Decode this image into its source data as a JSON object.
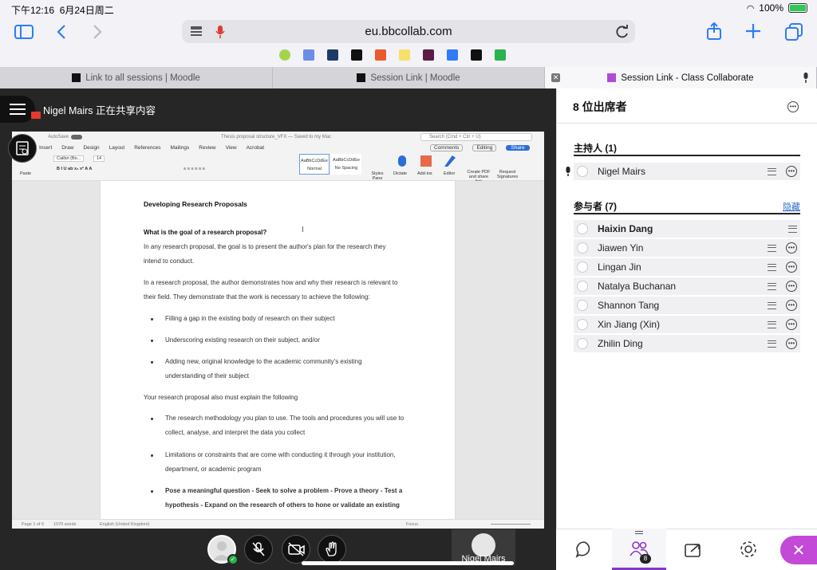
{
  "status_bar": {
    "time": "下午12:16",
    "date": "6月24日周二",
    "battery": "100%"
  },
  "browser": {
    "url": "eu.bbcollab.com"
  },
  "tabs": [
    {
      "label": "Link to all sessions | Moodle"
    },
    {
      "label": "Session Link | Moodle"
    },
    {
      "label": "Session Link - Class Collaborate"
    }
  ],
  "share_banner": {
    "text": "Nigel Mairs 正在共享内容"
  },
  "word": {
    "autosave": "AutoSave",
    "doc_title": "Thesis proposal structure_VFX — Saved to my Mac",
    "search": "Search (Cmd + Ctrl + U)",
    "menus": [
      "Home",
      "Insert",
      "Draw",
      "Design",
      "Layout",
      "References",
      "Mailings",
      "Review",
      "View",
      "Acrobat"
    ],
    "comments": "Comments",
    "editing": "Editing",
    "share": "Share",
    "font": "Calibri (Bo...",
    "size": "14",
    "styles": [
      "AaBbCcDdEe",
      "AaBbCcDdEe"
    ],
    "style_names": [
      "Normal",
      "No Spacing"
    ],
    "ribbon_tools": [
      "Styles Pane",
      "Dictate",
      "Add-ins",
      "Editor",
      "Create PDF and share link",
      "Request Signatures"
    ],
    "paste": "Paste",
    "status_page": "Page 1 of 6",
    "status_words": "1070 words",
    "status_lang": "English (United Kingdom)",
    "status_focus": "Focus",
    "body": {
      "heading": "Developing Research Proposals",
      "q1": "What is the goal of a research proposal?",
      "p1a": "In any research proposal, the goal is to present the author's plan for the research they",
      "p1b": "intend to conduct.",
      "p2a": "In a research proposal, the author demonstrates how and why their research is relevant to",
      "p2b": "their field. They demonstrate that the work is necessary to achieve the following:",
      "b1": "Filling a gap in the existing body of research on their subject",
      "b2": "Underscoring existing research on their subject, and/or",
      "b3a": "Adding new, original knowledge to the academic community's existing",
      "b3b": "understanding of their subject",
      "p3": "Your research proposal also must explain the following",
      "b4a": "The research methodology you plan to use. The tools and procedures you will use to",
      "b4b": "collect, analyse, and interpret the data you collect",
      "b5a": "Limitations or constraints that  are come with conducting it through your institution,",
      "b5b": "department, or academic program",
      "b6a": "Pose a meaningful question - Seek to solve a problem - Prove a theory - Test a",
      "b6b": "hypothesis - Expand on the research of others to hone or validate an existing"
    }
  },
  "presenter_tile": {
    "name": "Nigel Mairs"
  },
  "panel": {
    "title": "8 位出席者",
    "hosts_title": "主持人 (1)",
    "hosts": [
      {
        "name": "Nigel Mairs"
      }
    ],
    "participants_title": "参与者 (7)",
    "hide_label": "隐藏",
    "participants": [
      {
        "name": "Haixin Dang"
      },
      {
        "name": "Jiawen Yin"
      },
      {
        "name": "Lingan Jin"
      },
      {
        "name": "Natalya Buchanan"
      },
      {
        "name": "Shannon Tang"
      },
      {
        "name": "Xin Jiang (Xin)"
      },
      {
        "name": "Zhilin Ding"
      }
    ],
    "attendee_badge": "8"
  },
  "colors": {
    "accent": "#8a35c9",
    "close": "#c24ad6",
    "link": "#2a6cc7",
    "word_blue": "#2b6ed6"
  },
  "icons": [
    "sidebar-icon",
    "back-icon",
    "forward-icon",
    "reader-icon",
    "mic-icon",
    "reload-icon",
    "share-icon",
    "new-tab-icon",
    "tabs-icon",
    "chat-icon",
    "attendees-icon",
    "share-content-icon",
    "settings-icon",
    "close-icon",
    "more-icon",
    "list-icon"
  ]
}
